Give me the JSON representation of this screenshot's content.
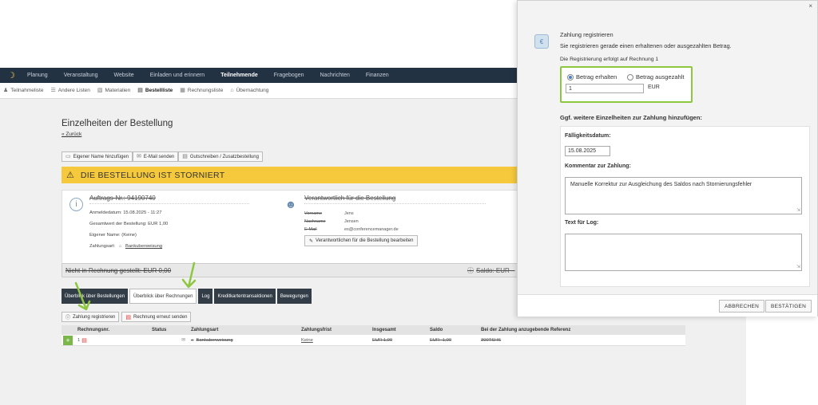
{
  "topnav": {
    "items": [
      "Planung",
      "Veranstaltung",
      "Website",
      "Einladen und erinnern",
      "Teilnehmende",
      "Fragebogen",
      "Nachrichten",
      "Finanzen"
    ],
    "active": "Teilnehmende"
  },
  "subnav": {
    "items": [
      "Teilnahmeliste",
      "Andere Listen",
      "Materialien",
      "Bestellliste",
      "Rechnungsliste",
      "Übernachtung"
    ],
    "active": "Bestellliste"
  },
  "page": {
    "title": "Einzelheiten der Bestellung",
    "back": "« Zurück"
  },
  "actions": [
    "Eigener Name hinzufügen",
    "E-Mail senden",
    "Gutschreiben / Zusatzbestellung"
  ],
  "banner": {
    "text": "DIE BESTELLUNG IST STORNIERT",
    "color": "#f5c93b"
  },
  "order": {
    "number": "Auftrags-Nr.: 94190740",
    "meta": [
      "Anmeldedatum: 15.08.2025 - 11:27",
      "Gesamtwert der Bestellung: EUR 1,00",
      "Eigener Name: (Keine)"
    ],
    "payment_label": "Zahlungsart:",
    "payment_value": "Bankuberweisung"
  },
  "responsible": {
    "title": "Verantwortlich für die Bestellung",
    "fields": [
      {
        "k": "Vorname",
        "v": "Jens"
      },
      {
        "k": "Nachname",
        "v": "Jensen"
      },
      {
        "k": "E-Mail",
        "v": "es@conferencemanager.de"
      }
    ],
    "edit_button": "Verantwortlichen für die Bestellung bearbeiten"
  },
  "summary": {
    "left": "Nicht in Rechnung gestellt: EUR 0,00",
    "right": "Saldo: EUR –"
  },
  "tabs": [
    "Überblick über Bestellungen",
    "Überblick über Rechnungen",
    "Log",
    "Kreditkartentransaktionen",
    "Bewegungen"
  ],
  "active_tab": "Überblick über Rechnungen",
  "invoice_buttons": [
    "Zahlung registrieren",
    "Rechnung erneut senden"
  ],
  "table": {
    "headers": [
      "Rechnungsnr.",
      "Status",
      "Zahlungsart",
      "Zahlungsfrist",
      "Insgesamt",
      "Saldo",
      "Bei der Zahlung anzugebende Referenz"
    ],
    "rows": [
      {
        "nr": "1",
        "status": "",
        "method": "Bankuberweisung",
        "due": "Keine",
        "total": "EUR 1,00",
        "balance": "EUR -1,00",
        "ref": "300TSHS"
      }
    ]
  },
  "modal": {
    "close": "×",
    "title": "Zahlung registrieren",
    "subtitle": "Sie registrieren gerade einen erhaltenen oder ausgezahlten Betrag.",
    "note": "Die Registrierung erfolgt auf Rechnung 1",
    "radio_received": "Betrag erhalten",
    "radio_paid": "Betrag ausgezahlt",
    "amount": "1",
    "currency": "EUR",
    "section": "Ggf. weitere Einzelheiten zur Zahlung hinzufügen:",
    "due_label": "Fälligkeitsdatum:",
    "due_value": "15.08.2025",
    "comment_label": "Kommentar zur Zahlung:",
    "comment_value": "Manuelle Korrektur zur Ausgleichung des Saldos nach Stornierungsfehler",
    "log_label": "Text für Log:",
    "log_value": "",
    "cancel": "ABBRECHEN",
    "confirm": "BESTÄTIGEN"
  },
  "colors": {
    "accent_green": "#8dc63f",
    "nav_dark": "#233243",
    "banner_yellow": "#f5c93b"
  }
}
